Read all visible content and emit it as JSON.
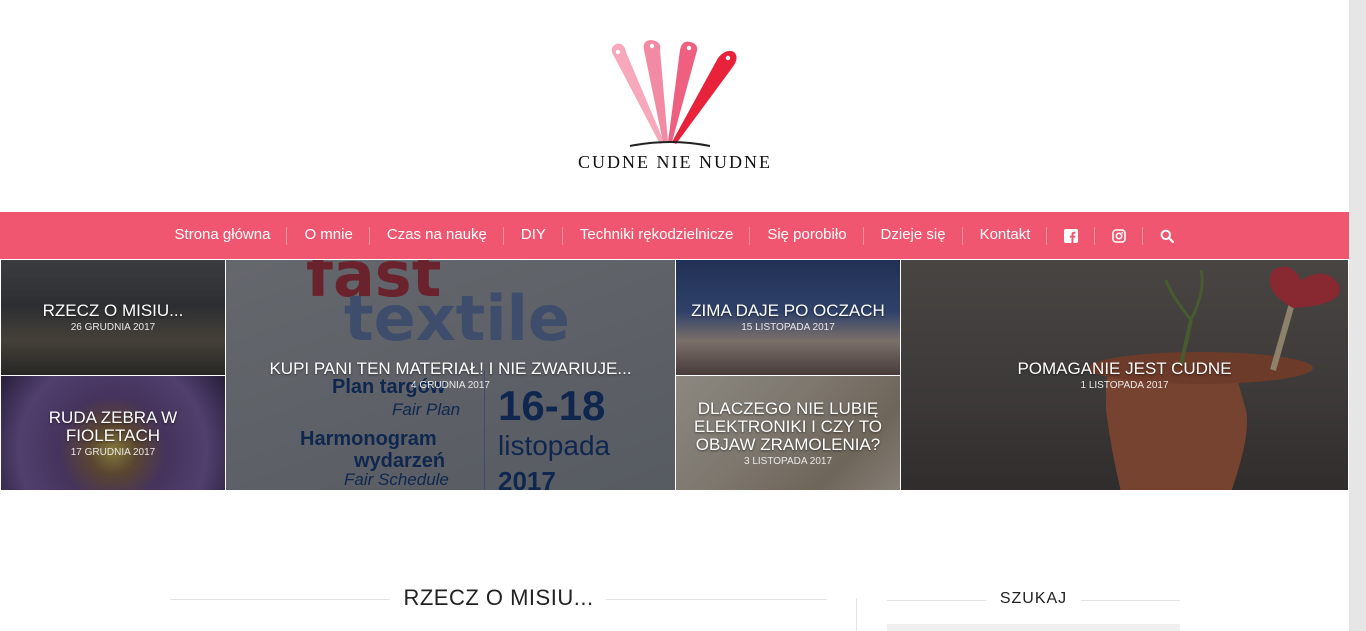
{
  "brand": {
    "logo_text": "CUDNE NIE NUDNE",
    "colors": {
      "nav_bg": "#f0566f",
      "logo_pink_light": "#f7a8ba",
      "logo_pink": "#f38aa3",
      "logo_rose": "#ef5f80",
      "logo_red": "#e8223b"
    }
  },
  "nav": {
    "items": [
      {
        "label": "Strona główna"
      },
      {
        "label": "O mnie"
      },
      {
        "label": "Czas na naukę"
      },
      {
        "label": "DIY"
      },
      {
        "label": "Techniki rękodzielnicze"
      },
      {
        "label": "Się porobiło"
      },
      {
        "label": "Dzieje się"
      },
      {
        "label": "Kontakt"
      }
    ],
    "icons": [
      "facebook-icon",
      "instagram-icon",
      "search-icon"
    ]
  },
  "featured": [
    {
      "title": "RZECZ O MISIU...",
      "date": "26 GRUDNIA 2017"
    },
    {
      "title": "RUDA ZEBRA W FIOLETACH",
      "date": "17 GRUDNIA 2017"
    },
    {
      "title": "KUPI PANI TEN MATERIAŁ! I NIE ZWARIUJE...",
      "date": "4 GRUDNIA 2017"
    },
    {
      "title": "ZIMA DAJE PO OCZACH",
      "date": "15 LISTOPADA 2017"
    },
    {
      "title": "DLACZEGO NIE LUBIĘ ELEKTRONIKI I CZY TO OBJAW ZRAMOLENIA?",
      "date": "3 LISTOPADA 2017"
    },
    {
      "title": "POMAGANIE JEST CUDNE",
      "date": "1 LISTOPADA 2017"
    }
  ],
  "poster": {
    "line1": "fast",
    "line2": "textile",
    "plan_pl": "Plan targów",
    "plan_en": "Fair Plan",
    "days": "16-18",
    "month": "listopada",
    "year": "2017",
    "harm_pl1": "Harmonogram",
    "harm_pl2": "wydarzeń",
    "harm_en": "Fair Schedule"
  },
  "main": {
    "heading": "RZECZ O MISIU..."
  },
  "sidebar": {
    "search_heading": "SZUKAJ"
  }
}
